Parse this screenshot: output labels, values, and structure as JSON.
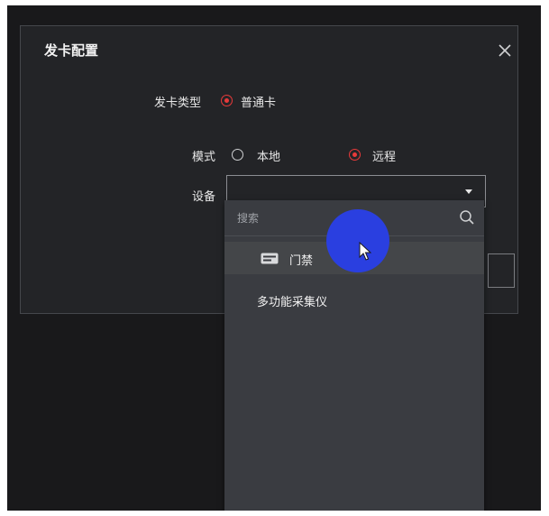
{
  "dialog": {
    "title": "发卡配置",
    "card_type_label": "发卡类型",
    "card_type_option": "普通卡",
    "mode_label": "模式",
    "mode_options": [
      {
        "label": "本地",
        "checked": false
      },
      {
        "label": "远程",
        "checked": true
      }
    ],
    "device_label": "设备",
    "device_value": ""
  },
  "dropdown": {
    "search_placeholder": "搜索",
    "options": [
      {
        "label": "门禁",
        "icon": "access-control-icon",
        "hovered": true
      },
      {
        "label": "多功能采集仪",
        "icon": "",
        "hovered": false
      }
    ]
  },
  "colors": {
    "accent_red": "#e83a3a",
    "cursor_halo": "#2a3fe0",
    "dialog_bg": "#232427",
    "dropdown_bg": "#3a3c41"
  }
}
